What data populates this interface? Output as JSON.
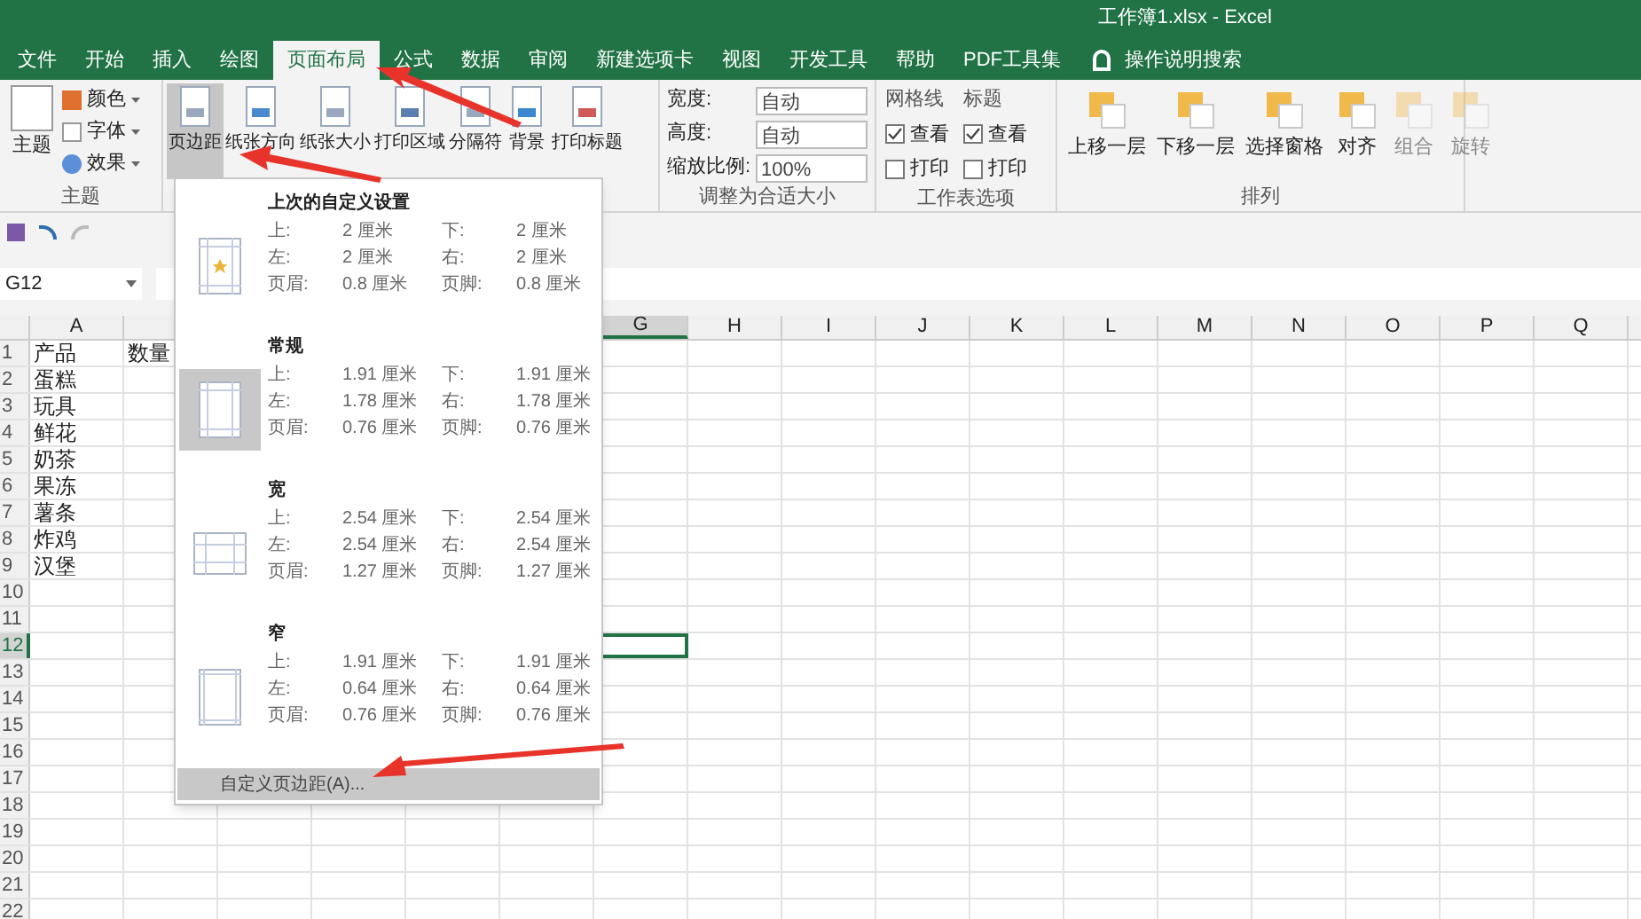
{
  "window": {
    "title": "工作簿1.xlsx  -  Excel"
  },
  "tabs": [
    {
      "label": "文件",
      "selected": false
    },
    {
      "label": "开始",
      "selected": false
    },
    {
      "label": "插入",
      "selected": false
    },
    {
      "label": "绘图",
      "selected": false
    },
    {
      "label": "页面布局",
      "selected": true
    },
    {
      "label": "公式",
      "selected": false
    },
    {
      "label": "数据",
      "selected": false
    },
    {
      "label": "审阅",
      "selected": false
    },
    {
      "label": "新建选项卡",
      "selected": false
    },
    {
      "label": "视图",
      "selected": false
    },
    {
      "label": "开发工具",
      "selected": false
    },
    {
      "label": "帮助",
      "selected": false
    },
    {
      "label": "PDF工具集",
      "selected": false
    }
  ],
  "tell_me": "操作说明搜索",
  "ribbon": {
    "theme_group": {
      "label": "主题",
      "big": "主题",
      "items": [
        "颜色",
        "字体",
        "效果"
      ]
    },
    "page_setup": {
      "buttons": [
        {
          "label": "页边距",
          "pressed": true
        },
        {
          "label": "纸张方向",
          "pressed": false
        },
        {
          "label": "纸张大小",
          "pressed": false
        },
        {
          "label": "打印区域",
          "pressed": false
        },
        {
          "label": "分隔符",
          "pressed": false
        },
        {
          "label": "背景",
          "pressed": false
        },
        {
          "label": "打印标题",
          "pressed": false
        }
      ]
    },
    "scale": {
      "label": "调整为合适大小",
      "fields": [
        {
          "label": "宽度:",
          "value": "自动"
        },
        {
          "label": "高度:",
          "value": "自动"
        },
        {
          "label": "缩放比例:",
          "value": "100%"
        }
      ]
    },
    "sheet_options": {
      "label": "工作表选项",
      "columns": [
        {
          "heading": "网格线",
          "options": [
            {
              "label": "查看",
              "checked": true
            },
            {
              "label": "打印",
              "checked": false
            }
          ]
        },
        {
          "heading": "标题",
          "options": [
            {
              "label": "查看",
              "checked": true
            },
            {
              "label": "打印",
              "checked": false
            }
          ]
        }
      ]
    },
    "arrange": {
      "label": "排列",
      "buttons": [
        {
          "label": "上移一层",
          "disabled": false
        },
        {
          "label": "下移一层",
          "disabled": false
        },
        {
          "label": "选择窗格",
          "disabled": false
        },
        {
          "label": "对齐",
          "disabled": false
        },
        {
          "label": "组合",
          "disabled": true
        },
        {
          "label": "旋转",
          "disabled": true
        }
      ]
    }
  },
  "name_box": "G12",
  "sheet": {
    "columns": [
      {
        "letter": "A",
        "selected": false
      },
      {
        "letter": "G",
        "selected": true
      },
      {
        "letter": "H",
        "selected": false
      },
      {
        "letter": "I",
        "selected": false
      },
      {
        "letter": "J",
        "selected": false
      },
      {
        "letter": "K",
        "selected": false
      },
      {
        "letter": "L",
        "selected": false
      },
      {
        "letter": "M",
        "selected": false
      },
      {
        "letter": "N",
        "selected": false
      },
      {
        "letter": "O",
        "selected": false
      },
      {
        "letter": "P",
        "selected": false
      },
      {
        "letter": "Q",
        "selected": false
      }
    ],
    "rows": [
      {
        "number": "1",
        "cells": [
          "产品",
          "数量"
        ],
        "selected": false
      },
      {
        "number": "2",
        "cells": [
          "蛋糕"
        ],
        "selected": false
      },
      {
        "number": "3",
        "cells": [
          "玩具"
        ],
        "selected": false
      },
      {
        "number": "4",
        "cells": [
          "鲜花"
        ],
        "selected": false
      },
      {
        "number": "5",
        "cells": [
          "奶茶"
        ],
        "selected": false
      },
      {
        "number": "6",
        "cells": [
          "果冻"
        ],
        "selected": false
      },
      {
        "number": "7",
        "cells": [
          "薯条"
        ],
        "selected": false
      },
      {
        "number": "8",
        "cells": [
          "炸鸡"
        ],
        "selected": false
      },
      {
        "number": "9",
        "cells": [
          "汉堡"
        ],
        "selected": false
      },
      {
        "number": "10",
        "cells": [],
        "selected": false
      },
      {
        "number": "11",
        "cells": [],
        "selected": false
      },
      {
        "number": "12",
        "cells": [],
        "selected": true
      },
      {
        "number": "13",
        "cells": [],
        "selected": false
      },
      {
        "number": "14",
        "cells": [],
        "selected": false
      },
      {
        "number": "15",
        "cells": [],
        "selected": false
      },
      {
        "number": "16",
        "cells": [],
        "selected": false
      },
      {
        "number": "17",
        "cells": [],
        "selected": false
      },
      {
        "number": "18",
        "cells": [],
        "selected": false
      },
      {
        "number": "19",
        "cells": [],
        "selected": false
      },
      {
        "number": "20",
        "cells": [],
        "selected": false
      },
      {
        "number": "21",
        "cells": [],
        "selected": false
      },
      {
        "number": "22",
        "cells": [],
        "selected": false
      }
    ]
  },
  "margins_menu": {
    "presets": [
      {
        "name": "上次的自定义设置",
        "kind": "custom",
        "selected": false,
        "values": [
          [
            "上:",
            "2 厘米",
            "下:",
            "2 厘米"
          ],
          [
            "左:",
            "2 厘米",
            "右:",
            "2 厘米"
          ],
          [
            "页眉:",
            "0.8 厘米",
            "页脚:",
            "0.8 厘米"
          ]
        ]
      },
      {
        "name": "常规",
        "kind": "normal",
        "selected": true,
        "values": [
          [
            "上:",
            "1.91 厘米",
            "下:",
            "1.91 厘米"
          ],
          [
            "左:",
            "1.78 厘米",
            "右:",
            "1.78 厘米"
          ],
          [
            "页眉:",
            "0.76 厘米",
            "页脚:",
            "0.76 厘米"
          ]
        ]
      },
      {
        "name": "宽",
        "kind": "wide",
        "selected": false,
        "values": [
          [
            "上:",
            "2.54 厘米",
            "下:",
            "2.54 厘米"
          ],
          [
            "左:",
            "2.54 厘米",
            "右:",
            "2.54 厘米"
          ],
          [
            "页眉:",
            "1.27 厘米",
            "页脚:",
            "1.27 厘米"
          ]
        ]
      },
      {
        "name": "窄",
        "kind": "narrow",
        "selected": false,
        "values": [
          [
            "上:",
            "1.91 厘米",
            "下:",
            "1.91 厘米"
          ],
          [
            "左:",
            "0.64 厘米",
            "右:",
            "0.64 厘米"
          ],
          [
            "页眉:",
            "0.76 厘米",
            "页脚:",
            "0.76 厘米"
          ]
        ]
      }
    ],
    "custom_item": {
      "label": "自定义页边距(A)...",
      "hovered": true
    }
  }
}
